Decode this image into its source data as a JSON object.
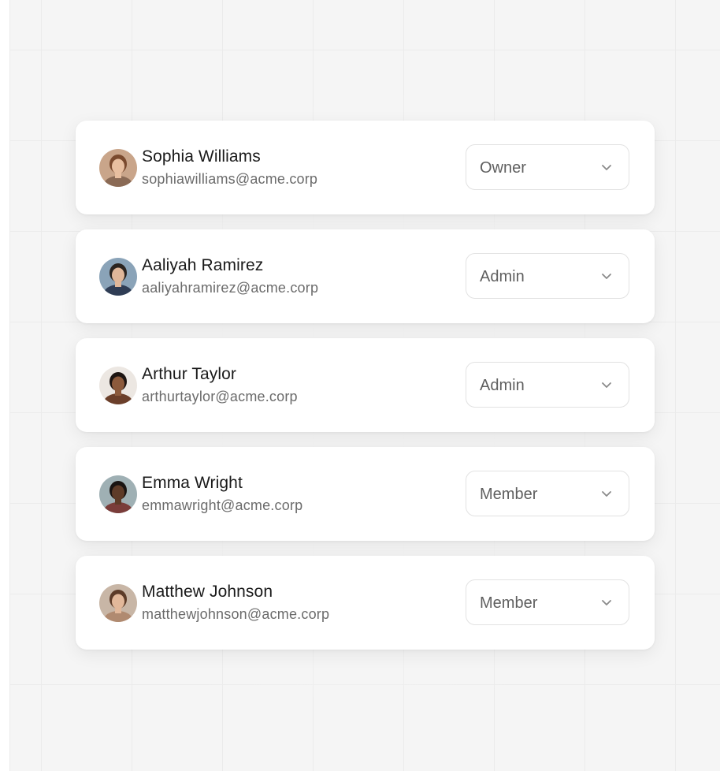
{
  "members": [
    {
      "name": "Sophia Williams",
      "email": "sophiawilliams@acme.corp",
      "role": "Owner",
      "avatar": {
        "icon": "avatar-photo",
        "bg": "#c9a58a",
        "skin": "#e8bfa0",
        "hair": "#7a4a2e",
        "shirt": "#8a6a55"
      }
    },
    {
      "name": "Aaliyah Ramirez",
      "email": "aaliyahramirez@acme.corp",
      "role": "Admin",
      "avatar": {
        "icon": "avatar-photo",
        "bg": "#8aa3b8",
        "skin": "#e0b79a",
        "hair": "#2b2420",
        "shirt": "#2f3d55"
      }
    },
    {
      "name": "Arthur Taylor",
      "email": "arthurtaylor@acme.corp",
      "role": "Admin",
      "avatar": {
        "icon": "avatar-photo",
        "bg": "#ece7e2",
        "skin": "#8c5a3c",
        "hair": "#1e1512",
        "shirt": "#6b3f2a"
      }
    },
    {
      "name": "Emma Wright",
      "email": "emmawright@acme.corp",
      "role": "Member",
      "avatar": {
        "icon": "avatar-photo",
        "bg": "#9fb0b4",
        "skin": "#5e3b28",
        "hair": "#1a1412",
        "shirt": "#7a3d3a"
      }
    },
    {
      "name": "Matthew Johnson",
      "email": "matthewjohnson@acme.corp",
      "role": "Member",
      "avatar": {
        "icon": "avatar-photo",
        "bg": "#c8b6a6",
        "skin": "#e2b89a",
        "hair": "#5c3b28",
        "shirt": "#b08a70"
      }
    }
  ],
  "chevron_icon": "chevron-down-icon",
  "colors": {
    "card": "#ffffff",
    "border": "#e2e2e2",
    "text": "#1a1a1a",
    "muted": "#6b6b6b"
  }
}
